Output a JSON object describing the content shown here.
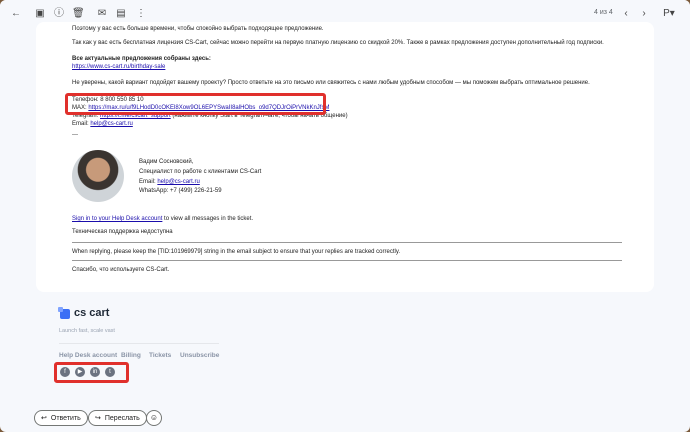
{
  "toolbar": {
    "counter": "4 из 4",
    "icons": [
      "back-arrow-icon",
      "archive-icon",
      "spam-icon",
      "delete-icon",
      "move-to-icon",
      "more-icon",
      "prev-icon",
      "next-icon",
      "input-tools-icon"
    ]
  },
  "body": {
    "line_top": "Поэтому у вас есть больше времени, чтобы спокойно выбрать подходящее предложение.",
    "line_license": "Так как у вас есть бесплатная лицензия CS-Cart, сейчас можно перейти на первую платную лицензию со скидкой 20%. Также в рамках предложения доступен дополнительный год подписки.",
    "offers_heading": "Все актуальные предложения собраны здесь:",
    "offers_link": "https://www.cs-cart.ru/birthday-sale",
    "line_unsure": "Не уверены, какой вариант подойдет вашему проекту? Просто ответьте на это письмо или свяжитесь с нами любым удобным способом — мы поможем выбрать оптимальное решение.",
    "phone": "Телефон: 8 800 550 85 10",
    "max_label": "MAX: ",
    "max_link": "https://max.ru/u/f9LHodD0cOKEl8Xow9OL6EPYSwaII8alHObs_o9d7QDJrOiPrVNkKnJfsM",
    "telegram_label": "Telegram: ",
    "telegram_link": "https://t.me/cscart_support",
    "telegram_note": " (нажмите кнопку Start в Telegram-чате, чтобы начать общение)",
    "email_label": "Email: ",
    "email_link": "help@cs-cart.ru",
    "dashes": "---",
    "sig_name": "Вадим Сосновский,",
    "sig_role": "Специалист по работе с клиентами CS-Cart",
    "sig_email_label": "Email: ",
    "sig_email": "help@cs-cart.ru",
    "sig_whatsapp": "WhatsApp: +7 (499) 226-21-59",
    "helpdesk_link": "Sign in to your Help Desk account",
    "helpdesk_rest": " to view all messages in the ticket.",
    "support_status": "Техническая поддержка недоступна",
    "reply_note": "When replying, please keep the [TID:101969979] string in the email subject to ensure that your replies are tracked correctly.",
    "thanks": "Спасибо, что используете CS-Cart."
  },
  "footer": {
    "brand": "cs cart",
    "tagline": "Launch fast, scale vast",
    "links": [
      "Help Desk account",
      "Billing",
      "Tickets",
      "Unsubscribe"
    ],
    "social": [
      "facebook-icon",
      "youtube-icon",
      "linkedin-icon",
      "twitter-icon"
    ]
  },
  "actions": {
    "reply": "Ответить",
    "forward": "Переслать"
  },
  "colors": {
    "highlight": "#e0302c",
    "link": "#1a0dab",
    "brand_blue": "#3b6ff5"
  }
}
